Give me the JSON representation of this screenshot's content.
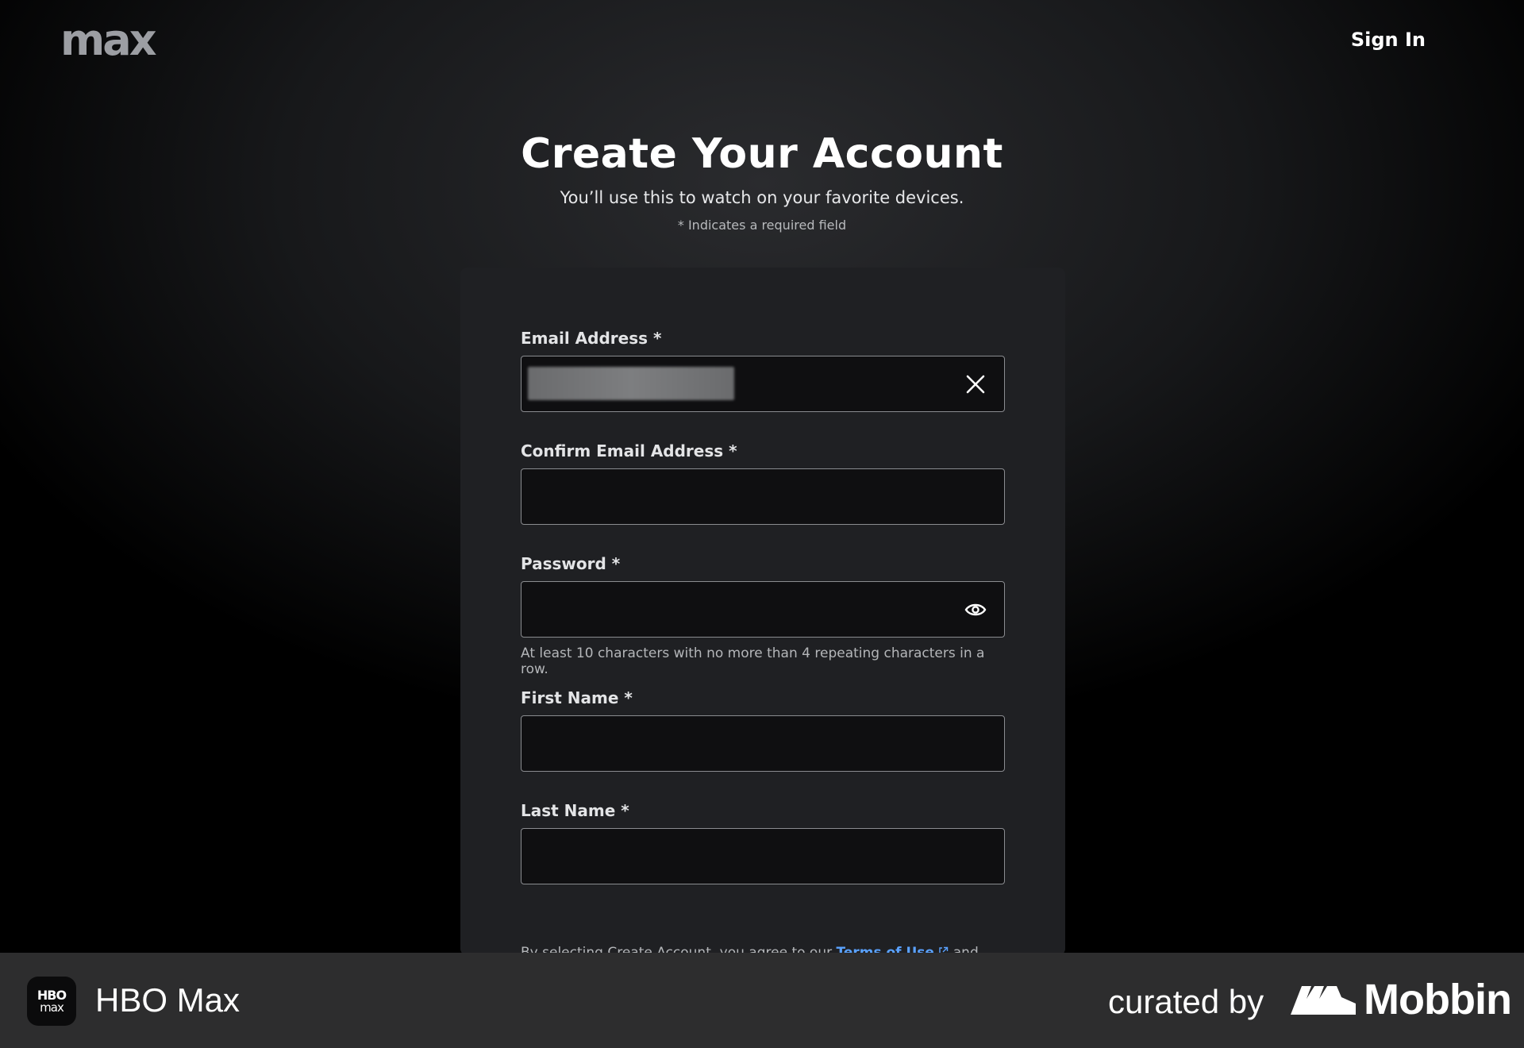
{
  "header": {
    "logo_text": "max",
    "sign_in_label": "Sign In"
  },
  "form_header": {
    "title": "Create Your Account",
    "subtitle": "You’ll use this to watch on your favorite devices.",
    "required_note": "* Indicates a required field"
  },
  "fields": {
    "email": {
      "label": "Email Address *",
      "value": ""
    },
    "confirm_email": {
      "label": "Confirm Email Address *",
      "value": ""
    },
    "password": {
      "label": "Password *",
      "value": "",
      "hint": "At least 10 characters with no more than 4 repeating characters in a row."
    },
    "first_name": {
      "label": "First Name *",
      "value": ""
    },
    "last_name": {
      "label": "Last Name *",
      "value": ""
    }
  },
  "terms": {
    "prefix": "By selecting Create Account, you agree to our ",
    "link_label": "Terms of Use",
    "suffix": " and"
  },
  "footer": {
    "app_icon_top": "HBO",
    "app_icon_bottom": "max",
    "app_name": "HBO Max",
    "curated_by": "curated by",
    "brand": "Mobbin"
  },
  "colors": {
    "link": "#5aa2ff",
    "card_bg": "#1f2023",
    "footer_bg": "#2d2d2e"
  }
}
